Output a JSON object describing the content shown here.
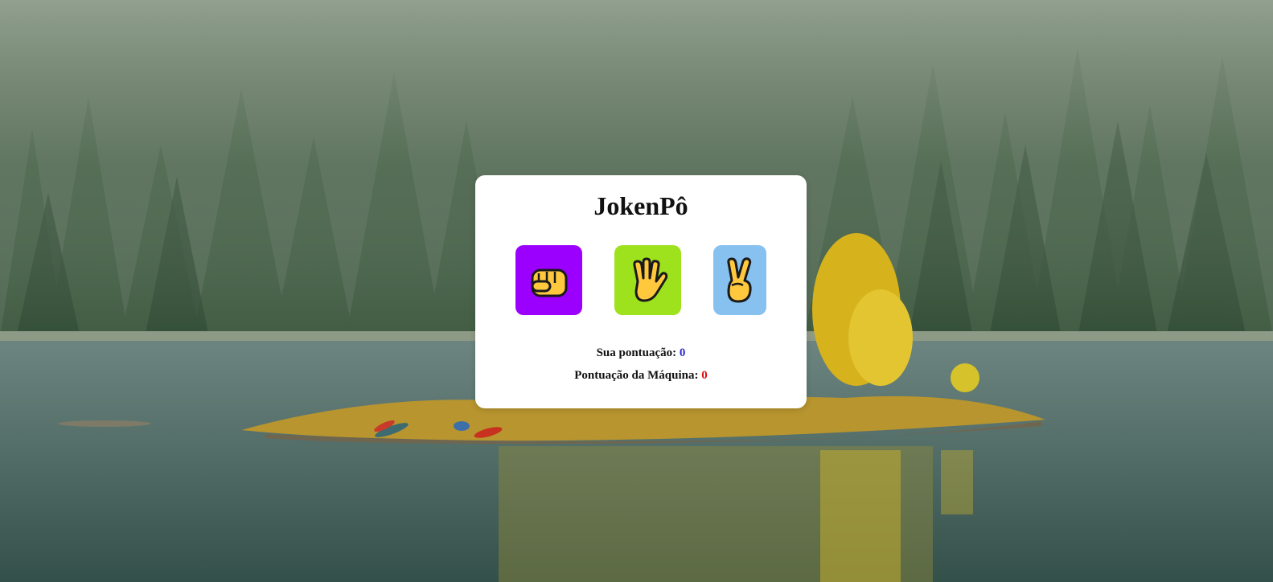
{
  "game": {
    "title": "JokenPô",
    "choices": [
      {
        "id": "rock",
        "icon": "fist-icon",
        "color": "#9b00ff"
      },
      {
        "id": "paper",
        "icon": "raised-hand-icon",
        "color": "#9ee21e"
      },
      {
        "id": "scissors",
        "icon": "victory-hand-icon",
        "color": "#86c1ef"
      }
    ],
    "score": {
      "user_label": "Sua pontuação:",
      "user_value": "0",
      "user_value_color": "#2a2ad0",
      "machine_label": "Pontuação da Máquina:",
      "machine_value": "0",
      "machine_value_color": "#e01010"
    }
  },
  "background": {
    "icon": "forest-lake-island-photo"
  }
}
